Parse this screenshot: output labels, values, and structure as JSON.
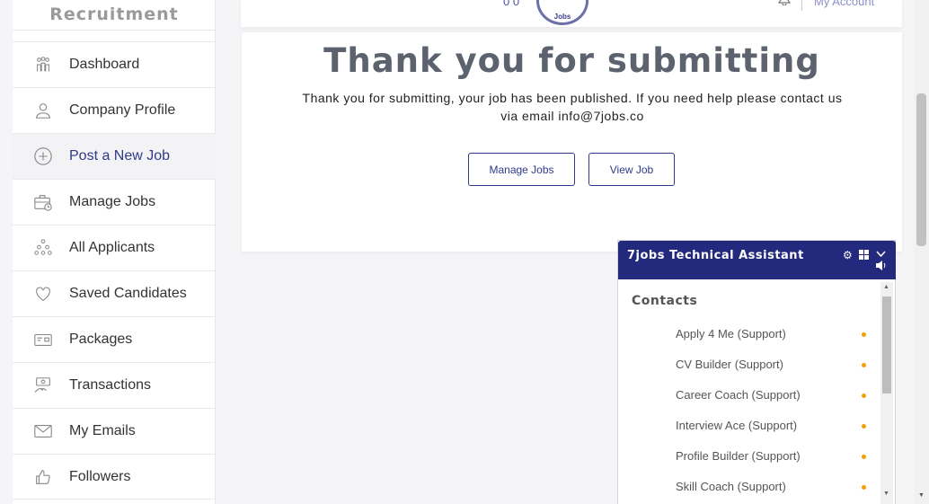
{
  "sidebar": {
    "heading": "Recruitment",
    "items": [
      {
        "label": "Dashboard",
        "icon": "dashboard-people-icon"
      },
      {
        "label": "Company Profile",
        "icon": "user-outline-icon"
      },
      {
        "label": "Post a New Job",
        "icon": "plus-circle-icon",
        "active": true
      },
      {
        "label": "Manage Jobs",
        "icon": "briefcase-clock-icon"
      },
      {
        "label": "All Applicants",
        "icon": "group-icon"
      },
      {
        "label": "Saved Candidates",
        "icon": "heart-icon"
      },
      {
        "label": "Packages",
        "icon": "card-package-icon"
      },
      {
        "label": "Transactions",
        "icon": "money-hand-icon"
      },
      {
        "label": "My Emails",
        "icon": "envelope-icon"
      },
      {
        "label": "Followers",
        "icon": "thumbs-up-icon"
      }
    ]
  },
  "header": {
    "dots": "0 0",
    "logo_text": "Jobs",
    "account_label": "My Account"
  },
  "main": {
    "title": "Thank you for submitting",
    "message": "Thank you for submitting, your job has been published. If you need help please contact us via email info@7jobs.co",
    "manage_jobs_label": "Manage Jobs",
    "view_job_label": "View Job"
  },
  "chat": {
    "title": "7jobs Technical Assistant",
    "contacts_title": "Contacts",
    "contacts": [
      {
        "name": "Apply 4 Me (Support)"
      },
      {
        "name": "CV Builder (Support)"
      },
      {
        "name": "Career Coach (Support)"
      },
      {
        "name": "Interview Ace (Support)"
      },
      {
        "name": "Profile Builder (Support)"
      },
      {
        "name": "Skill Coach (Support)"
      }
    ],
    "status_color": "#f5a000"
  },
  "colors": {
    "brand": "#232a7d",
    "accent": "#2e3a8c",
    "title_gray": "#5c636e"
  }
}
